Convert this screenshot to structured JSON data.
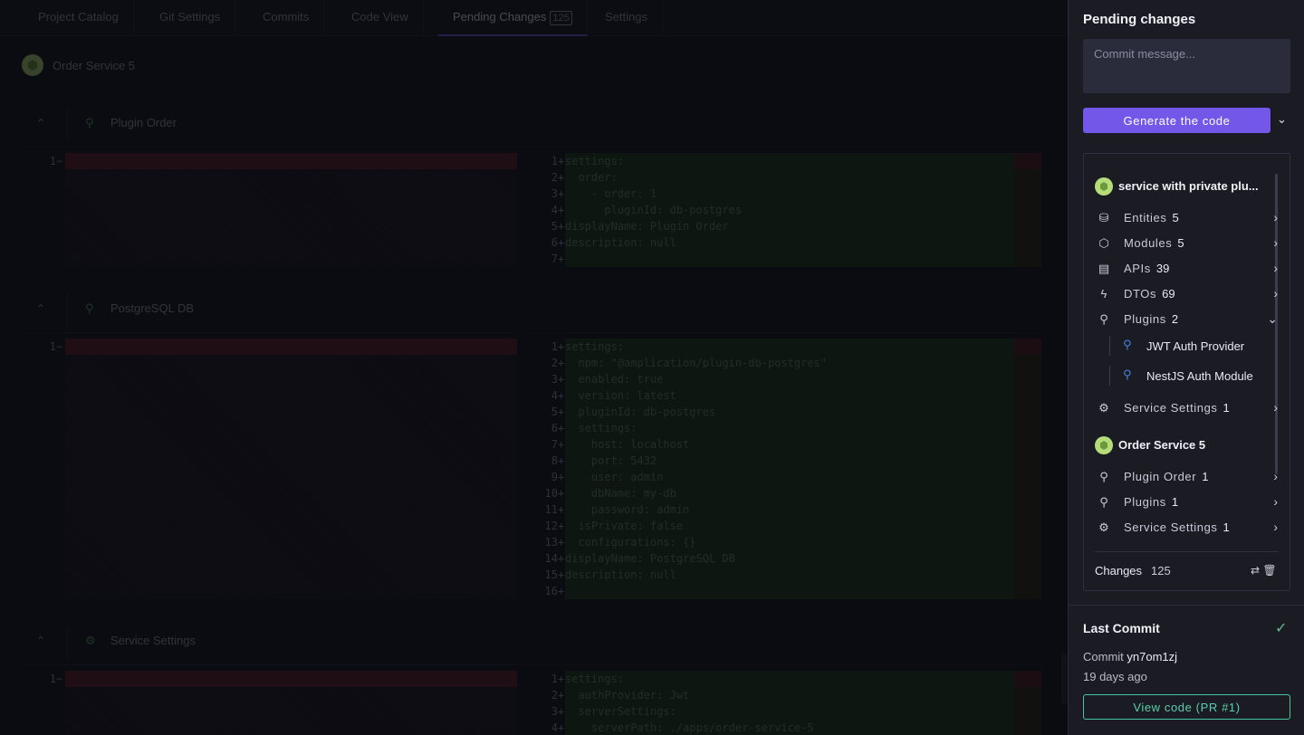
{
  "tabs": [
    {
      "label": "Project Catalog"
    },
    {
      "label": "Git Settings"
    },
    {
      "label": "Commits"
    },
    {
      "label": "Code View"
    },
    {
      "label": "Pending Changes",
      "badge": "125"
    },
    {
      "label": "Settings"
    }
  ],
  "breadcrumb": {
    "service": "Order Service 5"
  },
  "blocks": [
    {
      "title": "Plugin Order",
      "left_line": "1",
      "right_lines": [
        {
          "n": "1",
          "t": "settings:"
        },
        {
          "n": "2",
          "t": "  order:"
        },
        {
          "n": "3",
          "t": "    - order: 1"
        },
        {
          "n": "4",
          "t": "      pluginId: db-postgres"
        },
        {
          "n": "5",
          "t": "displayName: Plugin Order"
        },
        {
          "n": "6",
          "t": "description: null"
        },
        {
          "n": "7",
          "t": ""
        }
      ]
    },
    {
      "title": "PostgreSQL DB",
      "left_line": "1",
      "right_lines": [
        {
          "n": "1",
          "t": "settings:"
        },
        {
          "n": "2",
          "t": "  npm: \"@amplication/plugin-db-postgres\""
        },
        {
          "n": "3",
          "t": "  enabled: true"
        },
        {
          "n": "4",
          "t": "  version: latest"
        },
        {
          "n": "5",
          "t": "  pluginId: db-postgres"
        },
        {
          "n": "6",
          "t": "  settings:"
        },
        {
          "n": "7",
          "t": "    host: localhost"
        },
        {
          "n": "8",
          "t": "    port: 5432"
        },
        {
          "n": "9",
          "t": "    user: admin"
        },
        {
          "n": "10",
          "t": "    dbName: my-db"
        },
        {
          "n": "11",
          "t": "    password: admin"
        },
        {
          "n": "12",
          "t": "  isPrivate: false"
        },
        {
          "n": "13",
          "t": "  configurations: {}"
        },
        {
          "n": "14",
          "t": "displayName: PostgreSQL DB"
        },
        {
          "n": "15",
          "t": "description: null"
        },
        {
          "n": "16",
          "t": ""
        }
      ]
    },
    {
      "title": "Service Settings",
      "left_line": "1",
      "right_lines": [
        {
          "n": "1",
          "t": "settings:"
        },
        {
          "n": "2",
          "t": "  authProvider: Jwt"
        },
        {
          "n": "3",
          "t": "  serverSettings:"
        },
        {
          "n": "4",
          "t": "    serverPath: ./apps/order-service-5"
        }
      ]
    }
  ],
  "panel": {
    "title": "Pending changes",
    "commit_placeholder": "Commit message...",
    "generate_label": "Generate the code",
    "services": [
      {
        "name": "service with private plu...",
        "items": [
          {
            "label": "Entities",
            "count": "5",
            "icon": "database-icon",
            "glyph": "⛁"
          },
          {
            "label": "Modules",
            "count": "5",
            "icon": "cube-icon",
            "glyph": "⬡"
          },
          {
            "label": "APIs",
            "count": "39",
            "icon": "api-icon",
            "glyph": "▤"
          },
          {
            "label": "DTOs",
            "count": "69",
            "icon": "bolt-icon",
            "glyph": "ϟ"
          },
          {
            "label": "Plugins",
            "count": "2",
            "icon": "plug-icon",
            "glyph": "⚲",
            "expanded": true,
            "children": [
              "JWT Auth Provider",
              "NestJS Auth Module"
            ]
          },
          {
            "label": "Service Settings",
            "count": "1",
            "icon": "gear-icon",
            "glyph": "⚙"
          }
        ]
      },
      {
        "name": "Order Service 5",
        "items": [
          {
            "label": "Plugin Order",
            "count": "1",
            "icon": "plug-icon",
            "glyph": "⚲"
          },
          {
            "label": "Plugins",
            "count": "1",
            "icon": "plug-icon",
            "glyph": "⚲"
          },
          {
            "label": "Service Settings",
            "count": "1",
            "icon": "gear-icon",
            "glyph": "⚙"
          }
        ]
      }
    ],
    "changes_label": "Changes",
    "changes_count": "125",
    "last_commit": {
      "title": "Last Commit",
      "commit_label": "Commit",
      "commit_id": "yn7om1zj",
      "time": "19 days ago",
      "view_label": "View code (PR #1)"
    }
  }
}
